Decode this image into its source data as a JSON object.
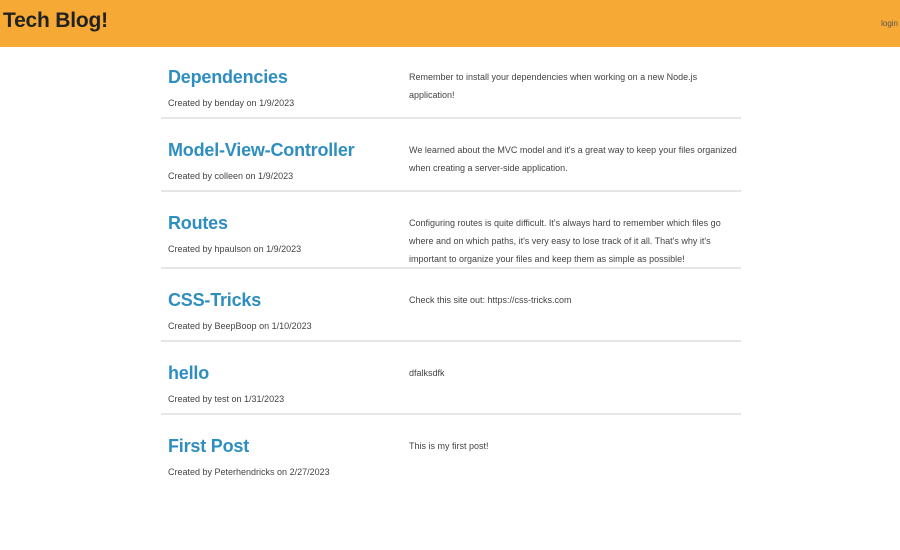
{
  "header": {
    "brand": "Tech Blog!",
    "login_label": "login",
    "background": "#f6a935"
  },
  "posts": [
    {
      "title": "Dependencies",
      "meta": "Created by benday on 1/9/2023",
      "body": "Remember to install your dependencies when working on a new Node.js application!"
    },
    {
      "title": "Model-View-Controller",
      "meta": "Created by colleen on 1/9/2023",
      "body": "We learned about the MVC model and it's a great way to keep your files organized when creating a server-side application."
    },
    {
      "title": "Routes",
      "meta": "Created by hpaulson on 1/9/2023",
      "body": "Configuring routes is quite difficult. It's always hard to remember which files go where and on which paths, it's very easy to lose track of it all. That's why it's important to organize your files and keep them as simple as possible!"
    },
    {
      "title": "CSS-Tricks",
      "meta": "Created by BeepBoop on 1/10/2023",
      "body": "Check this site out: https://css-tricks.com"
    },
    {
      "title": "hello",
      "meta": "Created by test on 1/31/2023",
      "body": "dfalksdfk"
    },
    {
      "title": "First Post",
      "meta": "Created by Peterhendricks on 2/27/2023",
      "body": "This is my first post!"
    }
  ],
  "colors": {
    "title_link": "#2f8ec0",
    "divider": "#e6e6e6"
  }
}
